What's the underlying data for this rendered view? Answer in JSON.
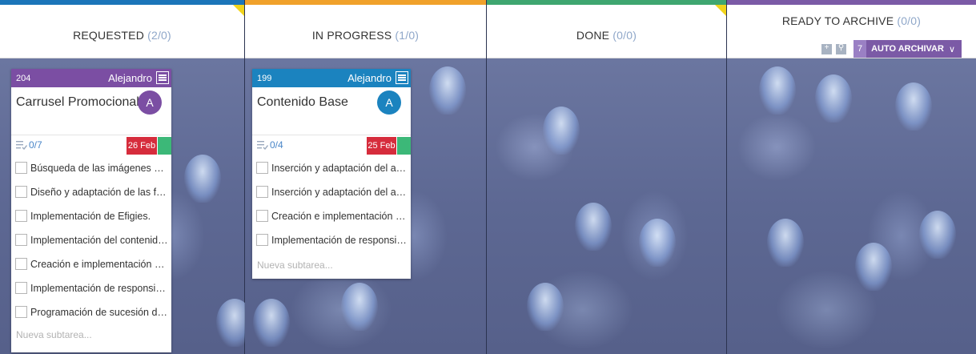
{
  "columns": [
    {
      "title": "REQUESTED",
      "count": "(2/0)",
      "accent": "#1b75b9",
      "cards": [
        {
          "id": "204",
          "owner": "Alejandro",
          "title": "Carrusel Promocional",
          "avatar": "A",
          "header_color": "#7b4ea3",
          "avatar_color": "#7b4ea3",
          "subtask_count": "0/7",
          "due": "26 Feb",
          "subtasks": [
            "Búsqueda de las imágenes que se utilizarán",
            "Diseño y adaptación de las figuras",
            "Implementación de Efigies.",
            "Implementación del contenido base",
            "Creación e implementación de animaciones",
            "Implementación de responsividad",
            "Programación de sucesión de imágenes"
          ],
          "new_subtask_placeholder": "Nueva subtarea..."
        }
      ]
    },
    {
      "title": "IN PROGRESS",
      "count": "(1/0)",
      "accent": "#f0a12b",
      "cards": [
        {
          "id": "199",
          "owner": "Alejandro",
          "title": "Contenido Base",
          "avatar": "A",
          "header_color": "#1b83bf",
          "avatar_color": "#1b83bf",
          "subtask_count": "0/4",
          "due": "25 Feb",
          "subtasks": [
            "Inserción y adaptación del apartado",
            "Inserción y adaptación del apartado",
            "Creación e implementación de animaciones",
            "Implementación de responsividad"
          ],
          "new_subtask_placeholder": "Nueva subtarea..."
        }
      ]
    },
    {
      "title": "DONE",
      "count": "(0/0)",
      "accent": "#3fa670"
    },
    {
      "title": "READY TO ARCHIVE",
      "count": "(0/0)",
      "accent": "#7b5aa6",
      "auto_archive": {
        "number": "7",
        "label": "AUTO ARCHIVAR",
        "chevron": "∨"
      },
      "tool_icons": [
        "archive-icon",
        "search-icon"
      ]
    }
  ],
  "colors": {
    "due_red": "#d62c3c",
    "done_green": "#3cb878",
    "count_blue": "#8fa7c9",
    "corner_yellow": "#f2d41b"
  }
}
